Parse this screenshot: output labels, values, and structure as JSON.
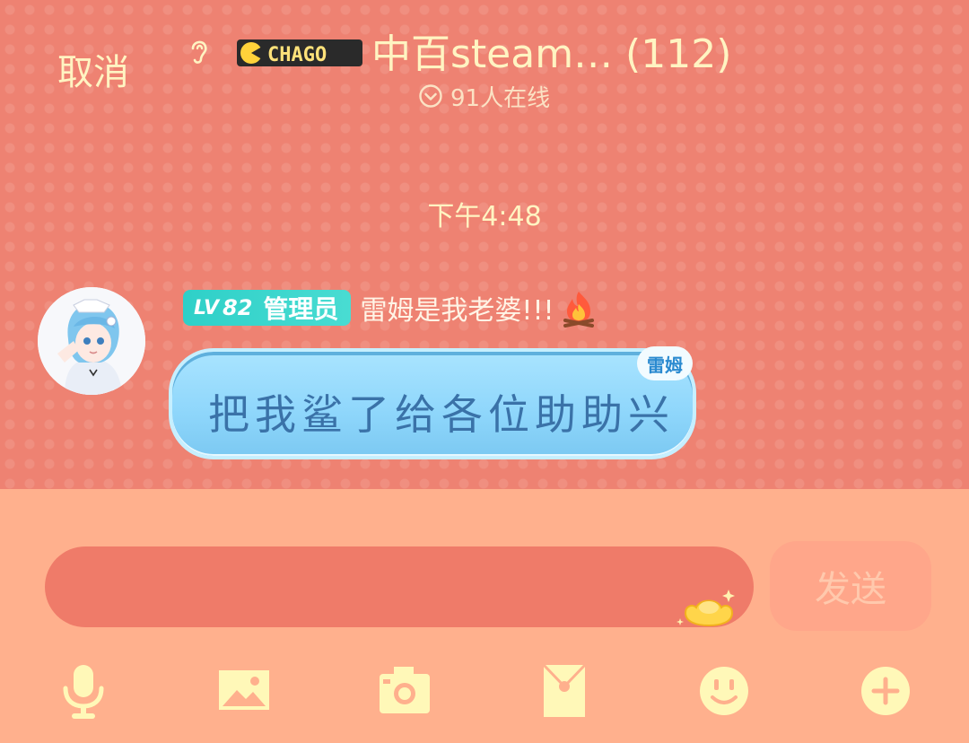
{
  "header": {
    "cancel_label": "取消",
    "logo_text": "CHAGO",
    "group_title": "中百steam… (112)",
    "online_text": "91人在线"
  },
  "chat": {
    "timestamp": "下午4:48",
    "messages": [
      {
        "level_prefix": "LV",
        "level": "82",
        "role": "管理员",
        "nickname": "雷姆是我老婆!!!",
        "text": "把我鲨了给各位助助兴",
        "bubble_tag": "雷姆"
      }
    ]
  },
  "composer": {
    "input_value": "",
    "send_label": "发送"
  },
  "toolbar": {
    "icons": [
      "microphone-icon",
      "image-icon",
      "camera-icon",
      "red-packet-icon",
      "emoji-icon",
      "plus-icon"
    ]
  },
  "colors": {
    "header_text": "#fff4c2",
    "chat_bg": "#ee8272",
    "input_area_bg": "#ffb08d",
    "bubble": "#9edcfd",
    "badge": "#2ed0c8",
    "toolbar_icon": "#fff8b8"
  }
}
